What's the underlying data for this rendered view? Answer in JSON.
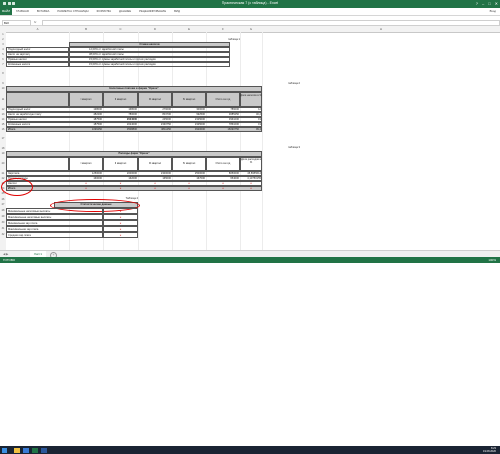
{
  "window": {
    "title": "Практическая 7 (с таблица) - Excel",
    "controls": [
      "?",
      "–",
      "□",
      "✕"
    ]
  },
  "ribbon": {
    "file": "ФАЙЛ",
    "tabs": [
      "ГЛАВНАЯ",
      "ВСТАВКА",
      "РАЗМЕТКА СТРАНИЦЫ",
      "ФОРМУЛЫ",
      "ДАННЫЕ",
      "РЕЦЕНЗИРОВАНИЕ",
      "ВИД"
    ],
    "account": "Вход"
  },
  "formula_bar": {
    "name_box": "B22",
    "fx": "fx",
    "value": ""
  },
  "columns": [
    "A",
    "B",
    "C",
    "D",
    "E",
    "F",
    "G",
    "H"
  ],
  "rows": [
    "1",
    "2",
    "3",
    "4",
    "5",
    "6",
    "7",
    "8",
    "9",
    "10",
    "11",
    "12",
    "13",
    "14",
    "15",
    "16",
    "17",
    "18",
    "19",
    "20",
    "21",
    "22",
    "23",
    "24",
    "25",
    "26",
    "27",
    "28",
    "29",
    "30",
    "31",
    "32"
  ],
  "t1": {
    "caption": "таблица 1",
    "header": "Ставки налогов",
    "rows": [
      {
        "name": "Подоходный налог",
        "rate": "12,00% от заработной платы"
      },
      {
        "name": "Налог на зарплату",
        "rate": "38,00% от заработной платы"
      },
      {
        "name": "Прямые налоги",
        "rate": "15,00% от суммы заработной платы и прочих расходов"
      },
      {
        "name": "Косвенные налоги",
        "rate": "15,00% от суммы заработной платы и прочих расходов"
      }
    ]
  },
  "t2": {
    "caption": "таблица 2",
    "title": "Налоговые платежи в фирме \"Орион\"",
    "headers": [
      "I квартал",
      "II квартал",
      "III квартал",
      "IV квартал",
      "Итого за год",
      "Доля налогов в %"
    ],
    "rows": [
      {
        "name": "Подоходный налог",
        "v": [
          "138000",
          "168000",
          "276000",
          "300000",
          "786000",
          "12"
        ]
      },
      {
        "name": "Налог на заработную плату",
        "v": [
          "482200",
          "780000",
          "803700",
          "992500",
          "3085250",
          "46,2"
        ]
      },
      {
        "name": "Прямые налоги",
        "v": [
          "187500",
          "2024000",
          "245000",
          "2325000",
          "3961000",
          "19"
        ]
      },
      {
        "name": "Косвенные налоги",
        "v": [
          "187500",
          "2024000",
          "2330750",
          "2325000",
          "7861000",
          "19"
        ]
      },
      {
        "name": "Итого",
        "v": [
          "1096250",
          "3508800",
          "3811250",
          "3920000",
          "16090750",
          "99,4"
        ]
      }
    ]
  },
  "t3": {
    "caption": "таблица 3",
    "title": "Расходы фирм \"Орион\"",
    "headers": [
      "I квартал",
      "II квартал",
      "III квартал",
      "IV квартал",
      "Итого за год",
      "Доля расходов в %"
    ],
    "rows": [
      {
        "name": "Зарплата",
        "v": [
          "1250000",
          "2000000",
          "2300000",
          "2500000",
          "8050000",
          "45,8955614"
        ]
      },
      {
        "name": "Прочие расходы",
        "v": [
          "160000",
          "162000",
          "165000",
          "167000",
          "654000",
          "4,10750155"
        ]
      },
      {
        "name": "Налоги",
        "v": [
          "*",
          "*",
          "*",
          "*",
          "*",
          "*"
        ]
      },
      {
        "name": "Итого",
        "v": [
          "*",
          "*",
          "*",
          "*",
          "*",
          "*"
        ]
      }
    ]
  },
  "t4": {
    "caption": "Таблица 4",
    "header": "Статистические данные",
    "rows": [
      {
        "name": "Минимальные налоговые выплаты",
        "v": "*"
      },
      {
        "name": "Максимальные налоговые выплаты",
        "v": "*"
      },
      {
        "name": "Минимальная зар.плата",
        "v": "*"
      },
      {
        "name": "Максимальная зар.плата",
        "v": "*"
      },
      {
        "name": "Средняя зар.плата",
        "v": "*"
      }
    ]
  },
  "sheet_tab": "Лист1",
  "status": {
    "left": "ГОТОВО",
    "right": "100%"
  },
  "clock": {
    "time": "8:23",
    "date": "19.08.2020"
  },
  "colors": {
    "excel_green": "#217346",
    "header_gray": "#c9c9c9",
    "annotation_red": "#e00000"
  }
}
